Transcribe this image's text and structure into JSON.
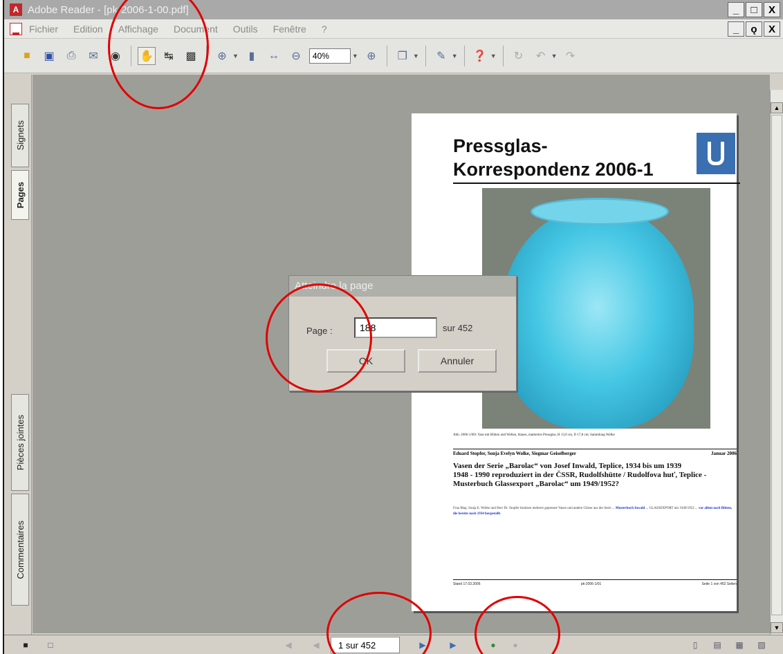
{
  "window": {
    "title": "Adobe Reader - [pk-2006-1-00.pdf]",
    "app_icon": "adobe-reader-icon",
    "minimize": "_",
    "maximize": "□",
    "close": "X",
    "restore": "ǫ"
  },
  "menu": [
    "Fichier",
    "Edition",
    "Affichage",
    "Document",
    "Outils",
    "Fenêtre",
    "?"
  ],
  "toolbar": {
    "zoom_value": "40%",
    "icons": [
      "open-icon",
      "save-icon",
      "print-icon",
      "email-icon",
      "search-icon",
      "hand-icon",
      "select-text-icon",
      "snapshot-icon",
      "zoom-in-icon",
      "actual-size-icon",
      "fit-width-icon",
      "zoom-out-icon",
      "zoom-plus-icon",
      "pages-icon",
      "signature-icon",
      "help-icon",
      "rotate-icon",
      "back-icon",
      "forward-icon"
    ]
  },
  "side_tabs": {
    "signets": "Signets",
    "pages": "Pages",
    "pieces": "Pièces jointes",
    "comments": "Commentaires"
  },
  "document": {
    "title": "Pressglas-\nKorrespondenz 2006-1",
    "caption": "Abb. 2006-1/001 Vase mit Blüten und Wellen, blaues, mattiertes Pressglas, H 13,0 cm, D 17,8 cm; Sammlung Wolke",
    "byline_left": "Eduard Stopfer, Sonja Evelyn Wolke, Siegmar Geiselberger",
    "byline_right": "Januar 2006",
    "article_title": "Vasen der Serie „Barolac“ von Josef Inwald, Teplice, 1934 bis um 1939\n1948 - 1990 reproduziert in der ČSSR, Rudolfshütte / Rudolfova huť, Teplice - Musterbuch Glassexport „Barolac“ um 1949/1952?",
    "body_prefix": "Frau Mag. Sonja E. Wolke und Herr Dr. Stopfer besitzen mehrere gepresste Vasen und andere Gläser aus der Serie ... ",
    "body_link1": "Musterbuch Inwald",
    "body_mid": " ... GLASSEXPORT um 1949/1952 ... ",
    "body_link2": "vor allem nach Blüten, die bereits nach 1934 hergestellt",
    "footer_left": "Stand 17.03.2006",
    "footer_mid": "pk-2006-1/01",
    "footer_right": "Seite 1 von 452 Seiten"
  },
  "dialog": {
    "title": "Atteindre la page",
    "label": "Page :",
    "input_value": "188",
    "of_text": "sur 452",
    "ok": "OK",
    "cancel": "Annuler"
  },
  "statusbar": {
    "page_indicator": "1 sur 452"
  }
}
